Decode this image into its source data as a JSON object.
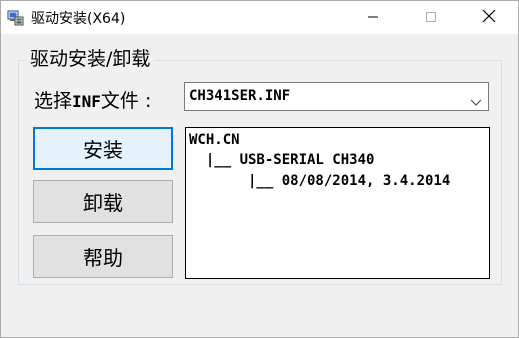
{
  "window": {
    "title": "驱动安装(X64)",
    "icon": "computer-install-icon"
  },
  "titlebar_buttons": {
    "minimize_icon": "minimize-icon",
    "maximize_icon": "maximize-icon",
    "close_icon": "close-icon"
  },
  "group": {
    "caption": "驱动安装/卸载"
  },
  "inf_select": {
    "label_prefix": "选择",
    "label_code": "INF",
    "label_suffix": "文件 :",
    "value": "CH341SER.INF",
    "arrow_icon": "chevron-down-icon"
  },
  "buttons": {
    "install": "安装",
    "uninstall": "卸载",
    "help": "帮助"
  },
  "info": {
    "line1": "WCH.CN",
    "line2": "  |__ USB-SERIAL CH340",
    "line3": "       |__ 08/08/2014, 3.4.2014"
  },
  "colors": {
    "focus_border": "#0078d7",
    "window_bg": "#f0f0f0"
  }
}
